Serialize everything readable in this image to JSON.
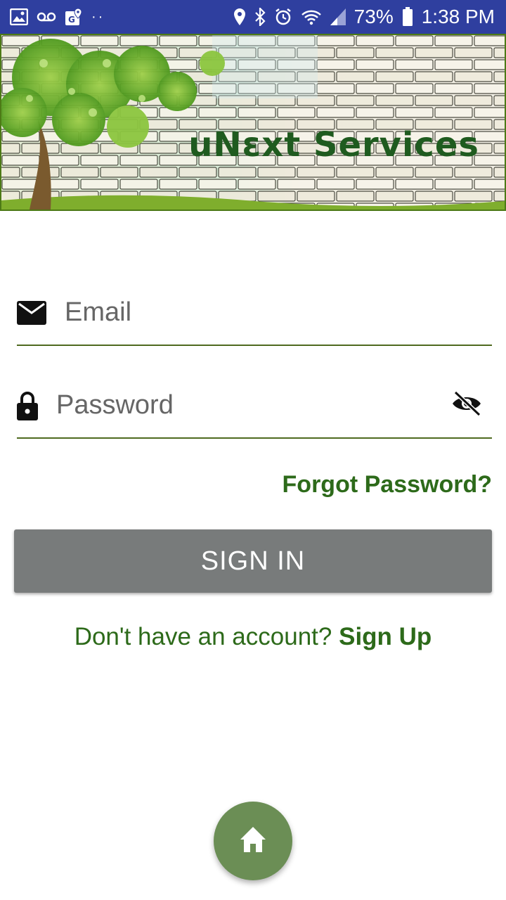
{
  "status_bar": {
    "battery": "73%",
    "time": "1:38 PM",
    "dots": "··",
    "icons": [
      "image-icon",
      "voicemail-icon",
      "maps-icon",
      "location-icon",
      "bluetooth-icon",
      "alarm-icon",
      "wifi-icon",
      "signal-icon",
      "battery-icon"
    ]
  },
  "banner": {
    "title": "uNεxt Services"
  },
  "form": {
    "email_placeholder": "Email",
    "password_placeholder": "Password",
    "email_icon": "mail-icon",
    "password_icon": "lock-icon",
    "visibility_icon": "eye-off-icon"
  },
  "actions": {
    "forgot_password": "Forgot Password?",
    "sign_in": "SIGN IN",
    "no_account": "Don't have an account?",
    "sign_up": "Sign Up"
  },
  "fab": {
    "icon": "home-icon"
  },
  "colors": {
    "status_bar": "#2f3f9f",
    "accent_green": "#2d6a1a",
    "button_gray": "#787b7b",
    "fab_green": "#6b8e55"
  }
}
